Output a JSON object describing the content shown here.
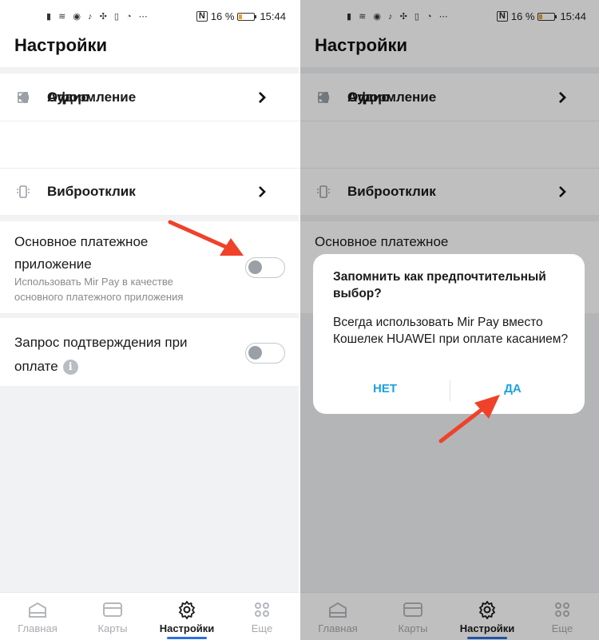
{
  "status_bar": {
    "battery": "16 %",
    "time": "15:44",
    "nfc": "N"
  },
  "header": {
    "title": "Настройки"
  },
  "menu": {
    "items": [
      {
        "label": "Аудио",
        "icon": "speaker-icon"
      },
      {
        "label": "Виброотклик",
        "icon": "vibration-icon"
      },
      {
        "label": "Оформление",
        "icon": "theme-icon"
      }
    ]
  },
  "payment": {
    "title": "Основное платежное приложение",
    "title_short": "Основное платежное",
    "subtitle": "Использовать Mir Pay в качестве основного платежного приложения",
    "enabled": false
  },
  "confirm": {
    "title": "Запрос подтверждения при оплате",
    "info": "i",
    "enabled": false
  },
  "nav": {
    "items": [
      {
        "label": "Главная",
        "icon": "home-icon"
      },
      {
        "label": "Карты",
        "icon": "card-icon"
      },
      {
        "label": "Настройки",
        "icon": "gear-icon",
        "active": true
      },
      {
        "label": "Еще",
        "icon": "more-icon"
      }
    ]
  },
  "dialog": {
    "title": "Запомнить как предпочтительный выбор?",
    "body": "Всегда использовать Mir Pay вместо Кошелек HUAWEI при оплате касанием?",
    "no": "НЕТ",
    "yes": "ДА"
  },
  "colors": {
    "accent": "#1ba2e0",
    "arrow": "#f0412a",
    "nav_active": "#2a6fe0"
  }
}
